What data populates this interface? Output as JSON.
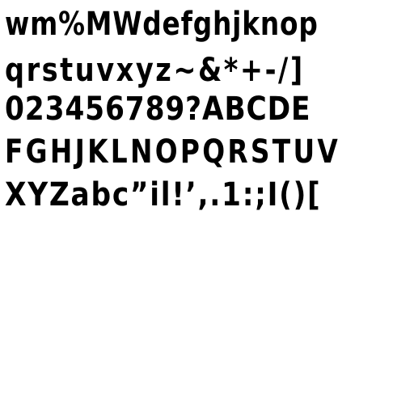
{
  "glyph_sheet": {
    "rows": [
      "wm%MWdefghjknop",
      "qrstuvxyz~&*+-/]",
      "023456789?ABCDE",
      "FGHJKLNOPQRSTUV",
      "XYZabc”il!’,.1:;I()["
    ]
  }
}
